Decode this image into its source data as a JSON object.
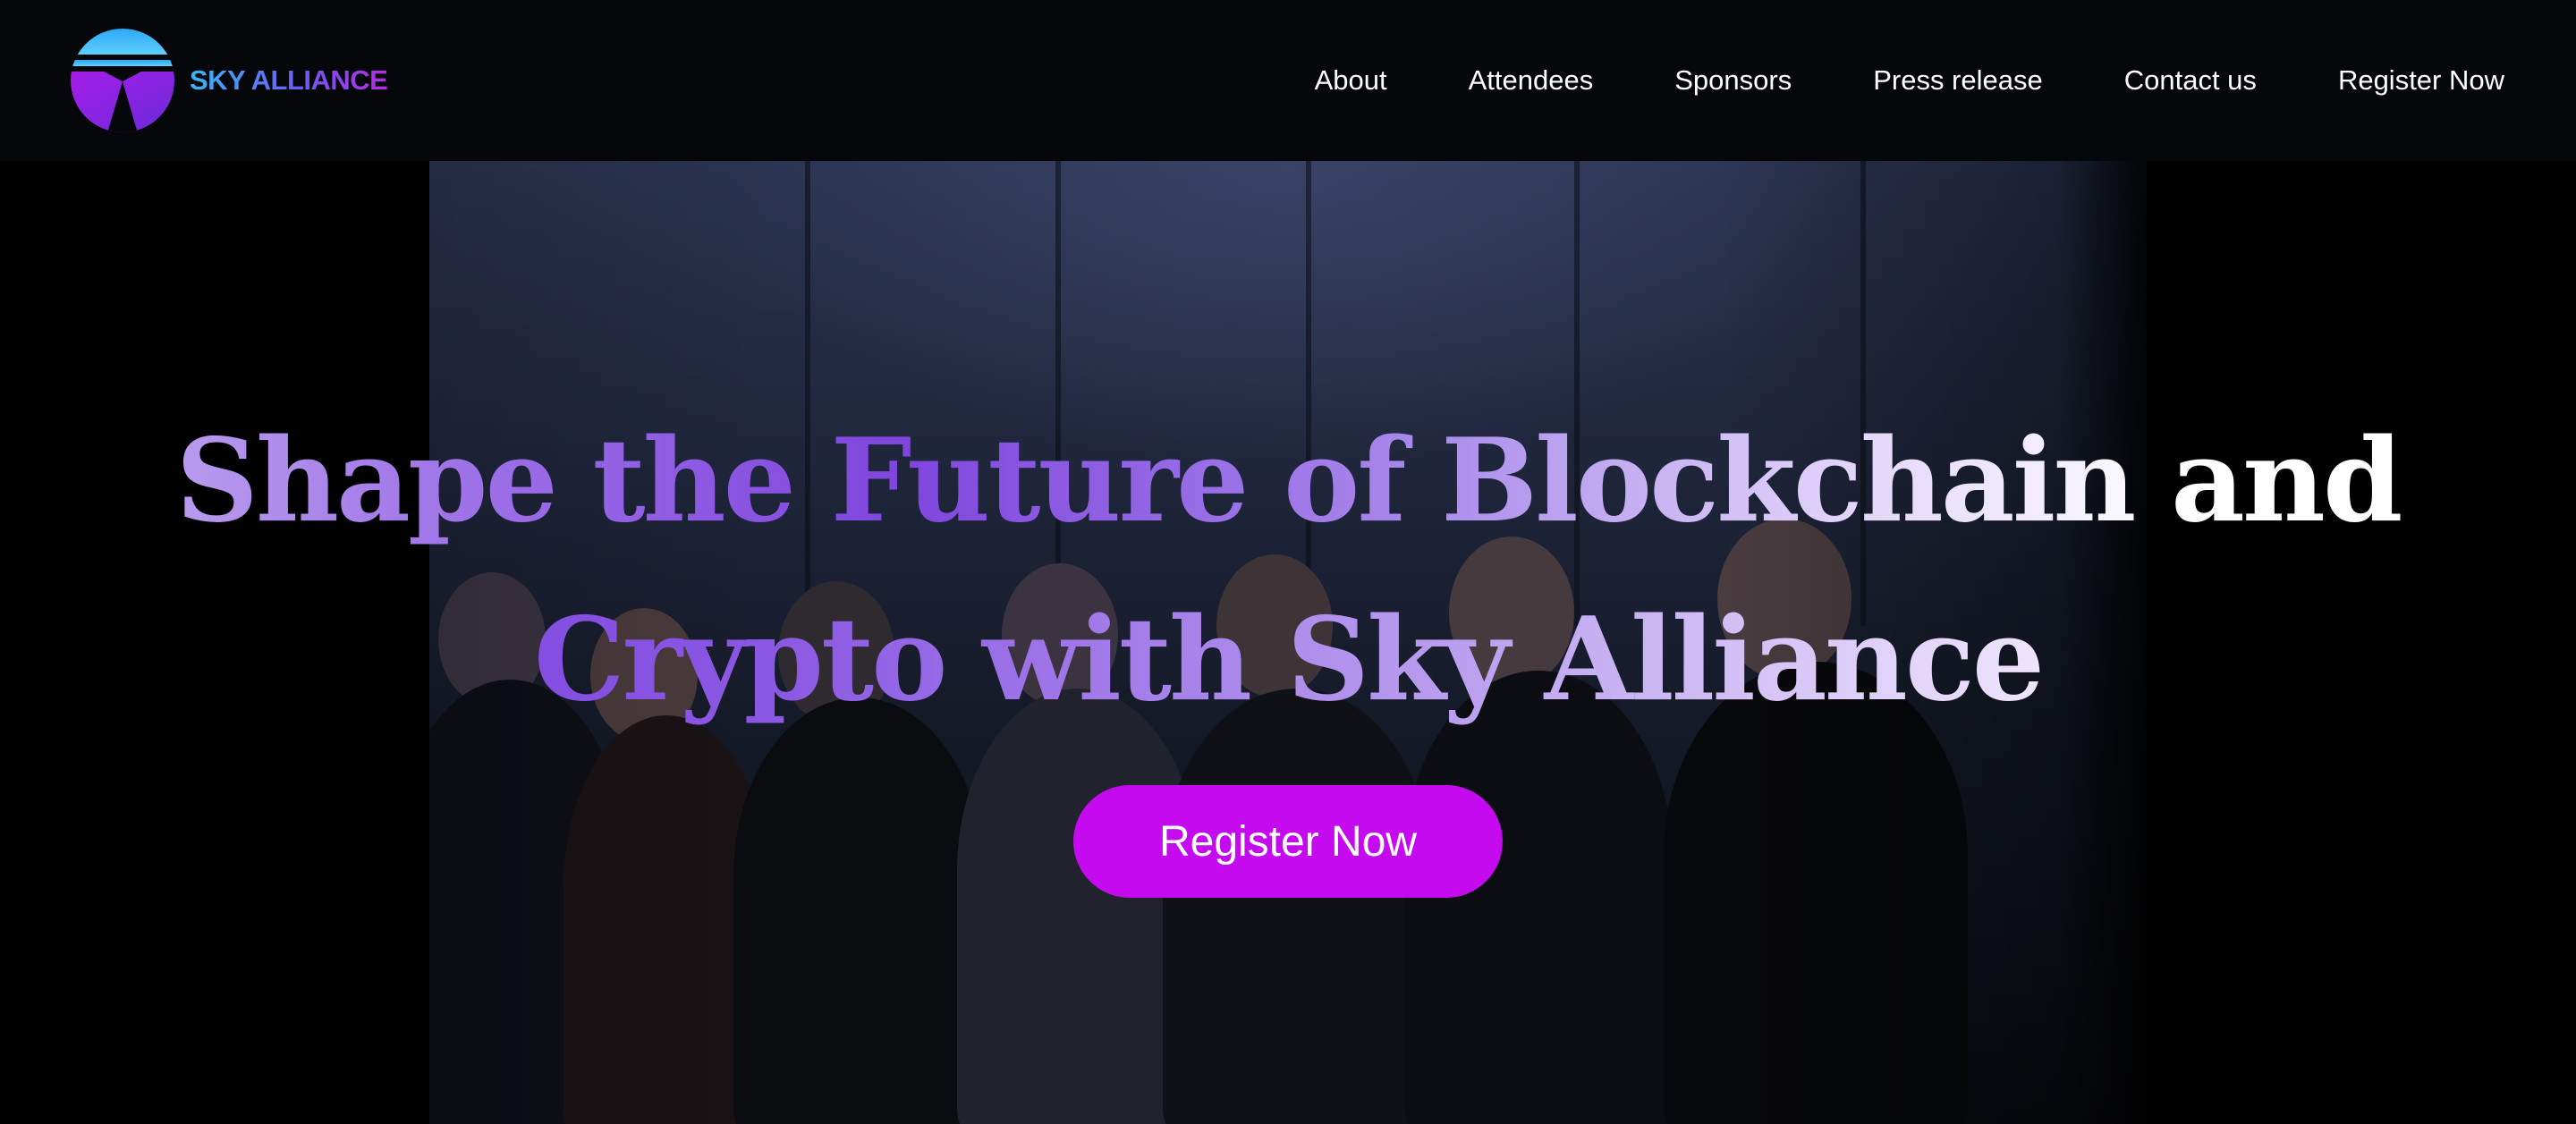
{
  "header": {
    "brand": {
      "name": "SKY ALLIANCE",
      "logo_icon": "sky-alliance-logo-icon"
    },
    "nav": [
      {
        "label": "About"
      },
      {
        "label": "Attendees"
      },
      {
        "label": "Sponsors"
      },
      {
        "label": "Press release"
      },
      {
        "label": "Contact us"
      },
      {
        "label": "Register Now"
      }
    ]
  },
  "hero": {
    "title_line1": "Shape the Future of Blockchain and",
    "title_line2": "Crypto with Sky Alliance",
    "cta_label": "Register Now"
  },
  "colors": {
    "header_bg": "#05070b",
    "page_bg": "#000000",
    "cta_bg": "#c50af0",
    "title_gradient_start": "#7f45de",
    "title_gradient_end": "#ffffff",
    "brand_blue": "#38b6f5",
    "brand_purple": "#b62be6"
  }
}
